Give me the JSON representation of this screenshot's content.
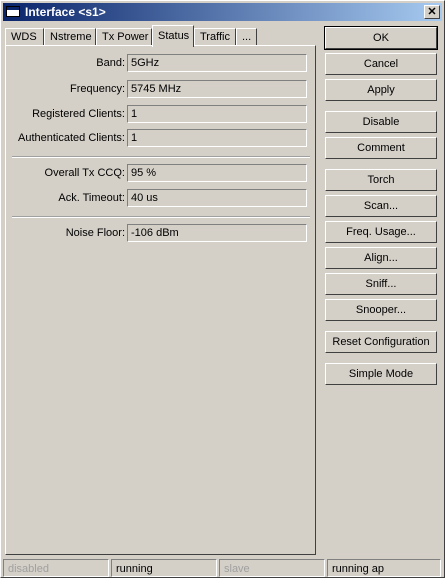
{
  "window": {
    "title": "Interface <s1>",
    "close_glyph": "✕"
  },
  "tabs": [
    {
      "label": "WDS"
    },
    {
      "label": "Nstreme"
    },
    {
      "label": "Tx Power"
    },
    {
      "label": "Status",
      "active": true
    },
    {
      "label": "Traffic"
    },
    {
      "label": "..."
    }
  ],
  "status": {
    "band": {
      "label": "Band:",
      "value": "5GHz"
    },
    "frequency": {
      "label": "Frequency:",
      "value": "5745 MHz"
    },
    "registered_clients": {
      "label": "Registered Clients:",
      "value": "1"
    },
    "authenticated_clients": {
      "label": "Authenticated Clients:",
      "value": "1"
    },
    "overall_tx_ccq": {
      "label": "Overall Tx CCQ:",
      "value": "95 %"
    },
    "ack_timeout": {
      "label": "Ack. Timeout:",
      "value": "40 us"
    },
    "noise_floor": {
      "label": "Noise Floor:",
      "value": "-106 dBm"
    }
  },
  "buttons": {
    "ok": "OK",
    "cancel": "Cancel",
    "apply": "Apply",
    "disable": "Disable",
    "comment": "Comment",
    "torch": "Torch",
    "scan": "Scan...",
    "freq_usage": "Freq. Usage...",
    "align": "Align...",
    "sniff": "Sniff...",
    "snooper": "Snooper...",
    "reset_configuration": "Reset Configuration",
    "simple_mode": "Simple Mode"
  },
  "statusbar": {
    "enabled_state": "disabled",
    "run_state": "running",
    "slave_state": "slave",
    "mode_state": "running ap"
  }
}
